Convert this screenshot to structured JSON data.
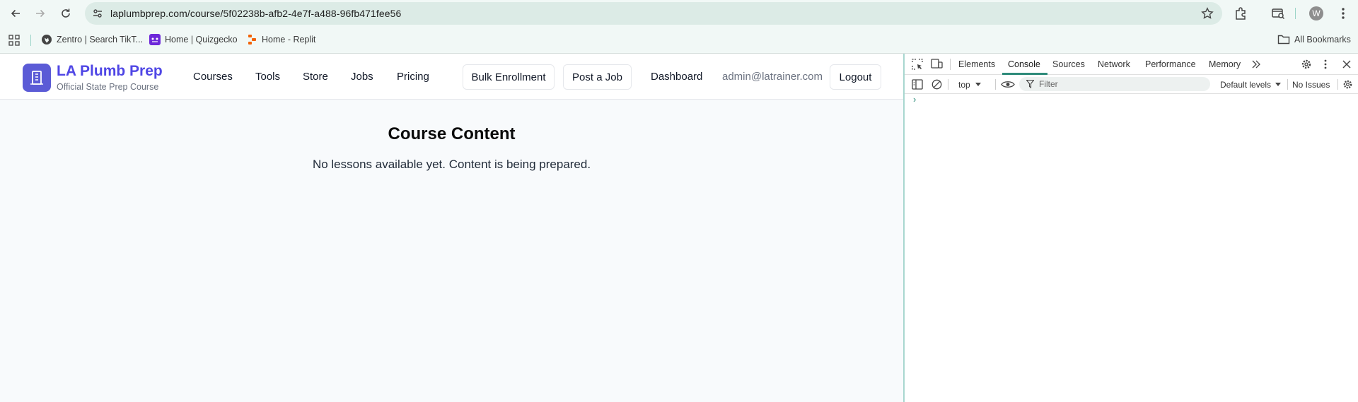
{
  "browser": {
    "url": "laplumbprep.com/course/5f02238b-afb2-4e7f-a488-96fb471fee56",
    "profile_initial": "W",
    "bookmarks": [
      {
        "label": "Zentro | Search TikT...",
        "icon": "globe-icon"
      },
      {
        "label": "Home | Quizgecko",
        "icon": "quizgecko-icon"
      },
      {
        "label": "Home - Replit",
        "icon": "replit-icon"
      }
    ],
    "all_bookmarks_label": "All Bookmarks"
  },
  "site": {
    "brand": {
      "name": "LA Plumb Prep",
      "subtitle": "Official State Prep Course"
    },
    "nav": [
      "Courses",
      "Tools",
      "Store",
      "Jobs",
      "Pricing"
    ],
    "bulk_enrollment_label": "Bulk Enrollment",
    "post_job_label": "Post a Job",
    "dashboard_label": "Dashboard",
    "user_email": "admin@latrainer.com",
    "logout_label": "Logout",
    "content": {
      "title": "Course Content",
      "message": "No lessons available yet. Content is being prepared."
    },
    "colors": {
      "brand": "#4f46e5",
      "logo_bg": "#5b5bd6"
    }
  },
  "devtools": {
    "tabs": [
      "Elements",
      "Console",
      "Sources",
      "Network",
      "Performance",
      "Memory"
    ],
    "active_tab": "Console",
    "context": "top",
    "filter_placeholder": "Filter",
    "levels": "Default levels",
    "issues": "No Issues",
    "prompt": "›",
    "accent": "#2e8b7a"
  }
}
